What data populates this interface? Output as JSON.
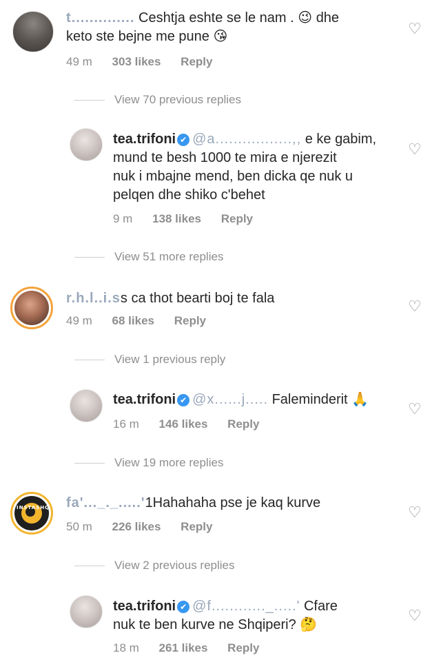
{
  "comments": [
    {
      "username": "t..............",
      "text": "Ceshtja eshte se le nam .",
      "emoji1": "😉",
      "text2": "dhe",
      "line2": "keto ste bejne me pune",
      "emoji2": "😘",
      "time": "49 m",
      "likes": "303 likes",
      "reply": "Reply"
    },
    {
      "username": "tea.trifoni",
      "mention": "@a.................,,",
      "line1": "e ke gabim,",
      "line2": "mund te besh 1000 te mira e njerezit",
      "line3": "nuk i mbajne mend, ben dicka qe nuk u",
      "line4": "pelqen dhe shiko c'behet",
      "time": "9 m",
      "likes": "138 likes",
      "reply": "Reply"
    },
    {
      "username": "r.h.l..i.s",
      "text": "s ca thot bearti boj te fala",
      "time": "49 m",
      "likes": "68 likes",
      "reply": "Reply"
    },
    {
      "username": "tea.trifoni",
      "mention": "@x......j.....",
      "text": "Faleminderit",
      "emoji": "🙏",
      "time": "16 m",
      "likes": "146 likes",
      "reply": "Reply"
    },
    {
      "username": "fa'..._._.....'",
      "text": "1Hahahaha pse je kaq kurve",
      "time": "50 m",
      "likes": "226 likes",
      "reply": "Reply"
    },
    {
      "username": "tea.trifoni",
      "mention": "@f............_.....'",
      "line1": "Cfare",
      "line2": "nuk te ben kurve ne Shqiperi?",
      "emoji": "🤔",
      "time": "18 m",
      "likes": "261 likes",
      "reply": "Reply"
    }
  ],
  "view_links": {
    "v1": "View 70 previous replies",
    "v2": "View 51 more replies",
    "v3": "View 1 previous reply",
    "v4": "View 19 more replies",
    "v5": "View 2 previous replies"
  },
  "verified_mark": "✔",
  "heart_glyph": "♡",
  "badge_text": "INSTASHQ",
  "colors": {
    "meta": "#8e8e8e",
    "verified": "#3897f0",
    "mention": "#00376b",
    "accent_ring": "#f4a23a"
  }
}
